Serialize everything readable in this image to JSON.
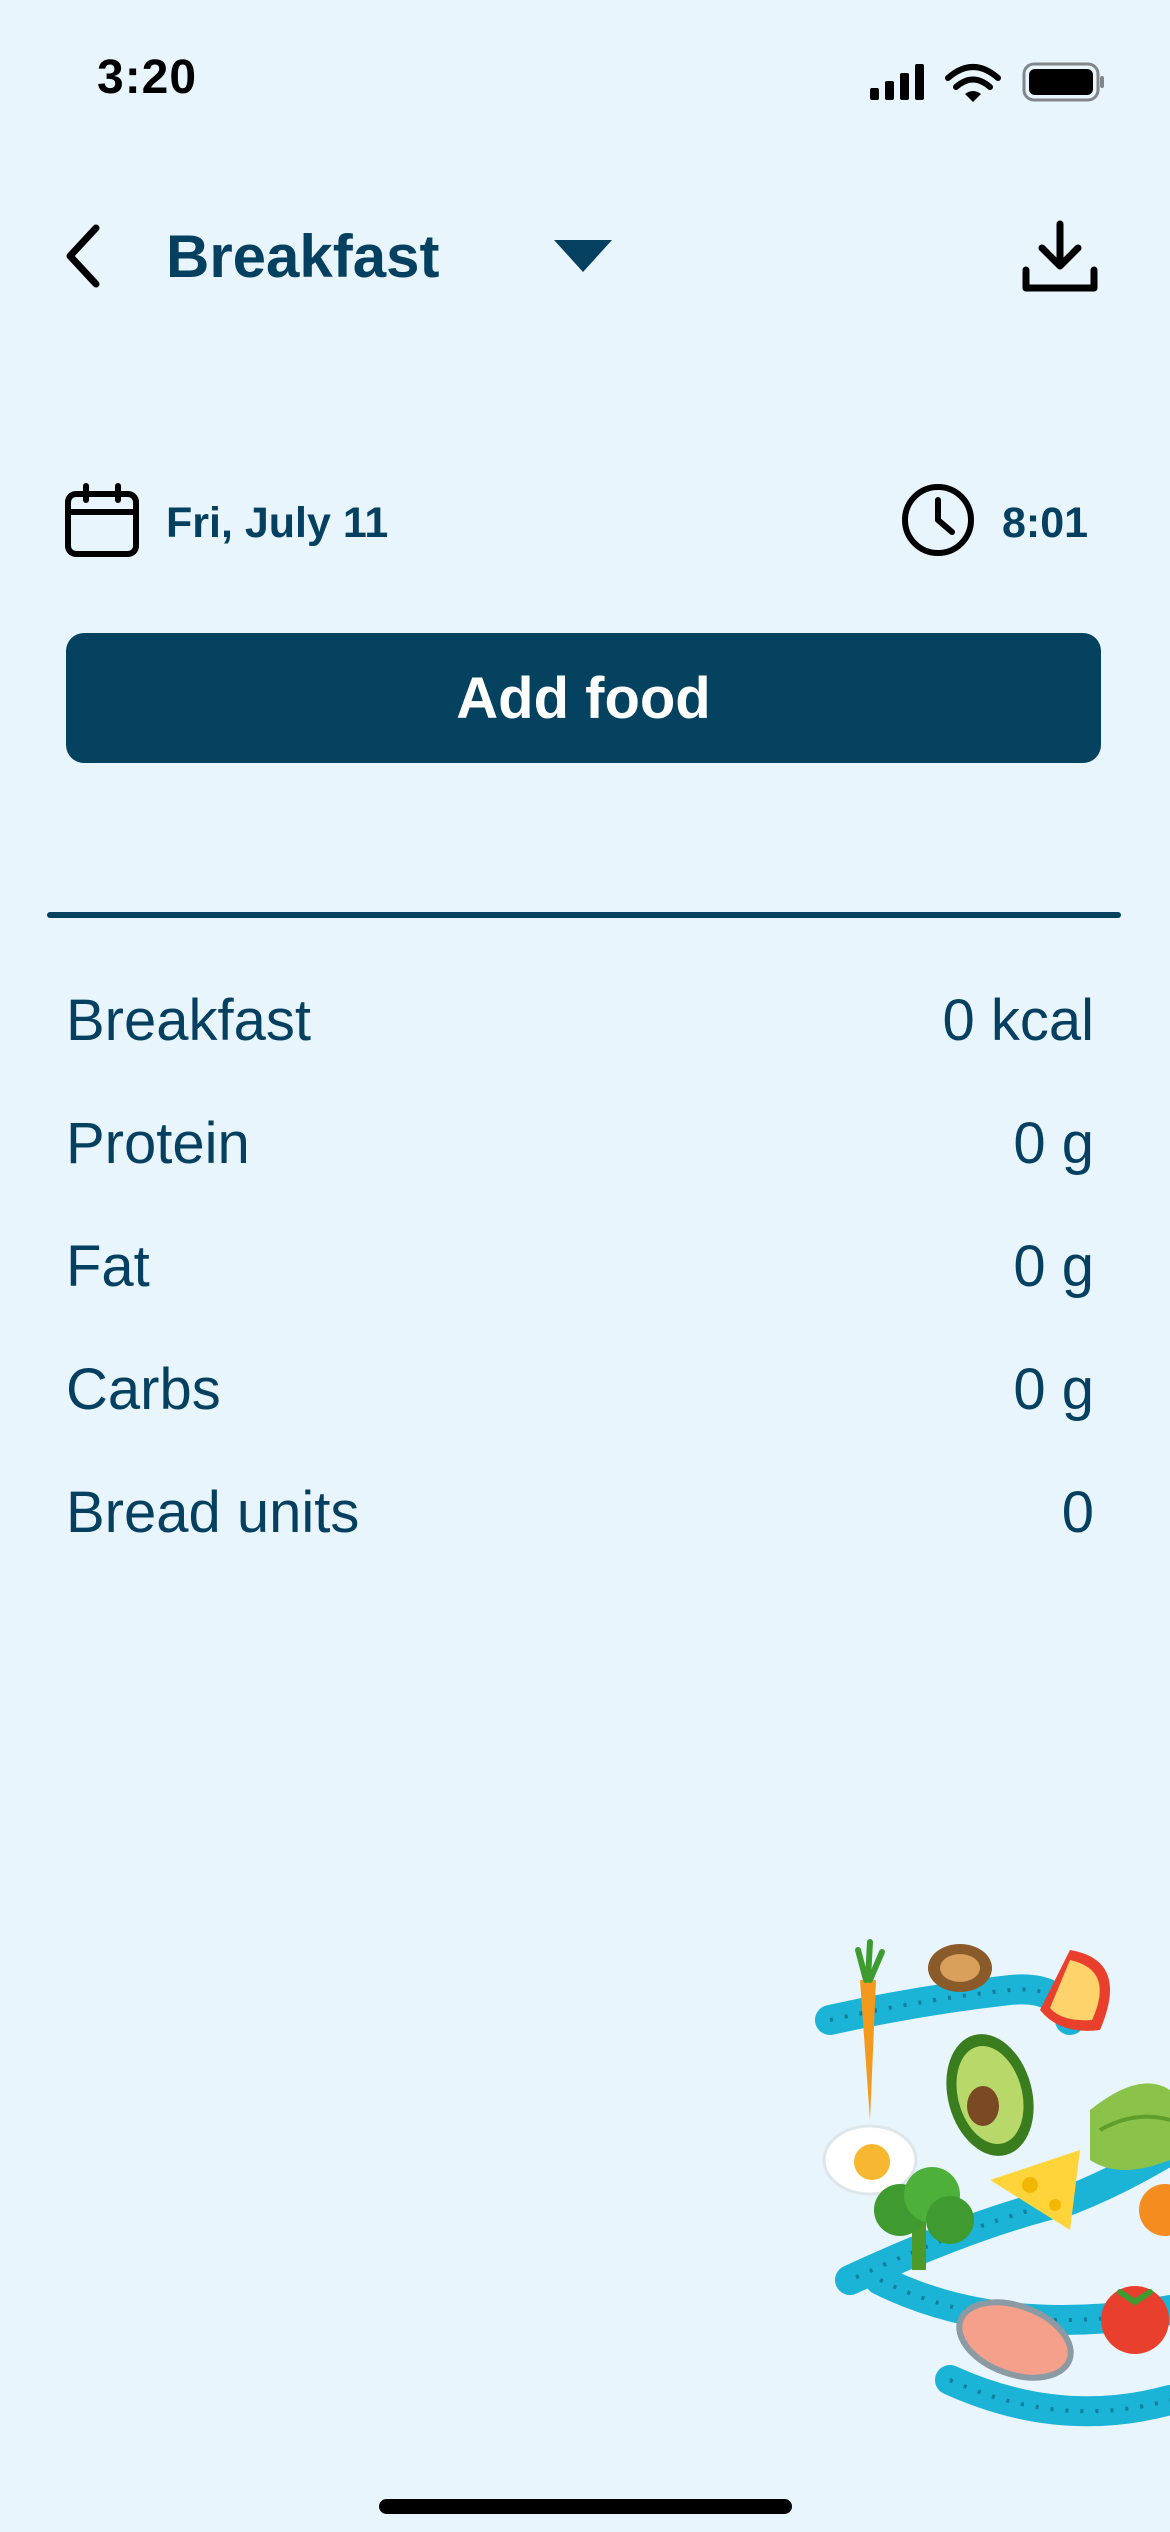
{
  "status_bar": {
    "time": "3:20"
  },
  "header": {
    "title": "Breakfast"
  },
  "meta": {
    "date": "Fri, July 11",
    "time": "8:01"
  },
  "actions": {
    "add_food_label": "Add food"
  },
  "nutrition": {
    "rows": [
      {
        "label": "Breakfast",
        "value": "0 kcal"
      },
      {
        "label": "Protein",
        "value": "0 g"
      },
      {
        "label": "Fat",
        "value": "0 g"
      },
      {
        "label": "Carbs",
        "value": "0 g"
      },
      {
        "label": "Bread units",
        "value": "0"
      }
    ]
  },
  "icons": {
    "back": "chevron-left-icon",
    "dropdown": "triangle-down-icon",
    "download": "download-icon",
    "calendar": "calendar-icon",
    "clock": "clock-icon"
  },
  "colors": {
    "background": "#E9F5FC",
    "primary": "#05425F",
    "text": "#064060"
  }
}
